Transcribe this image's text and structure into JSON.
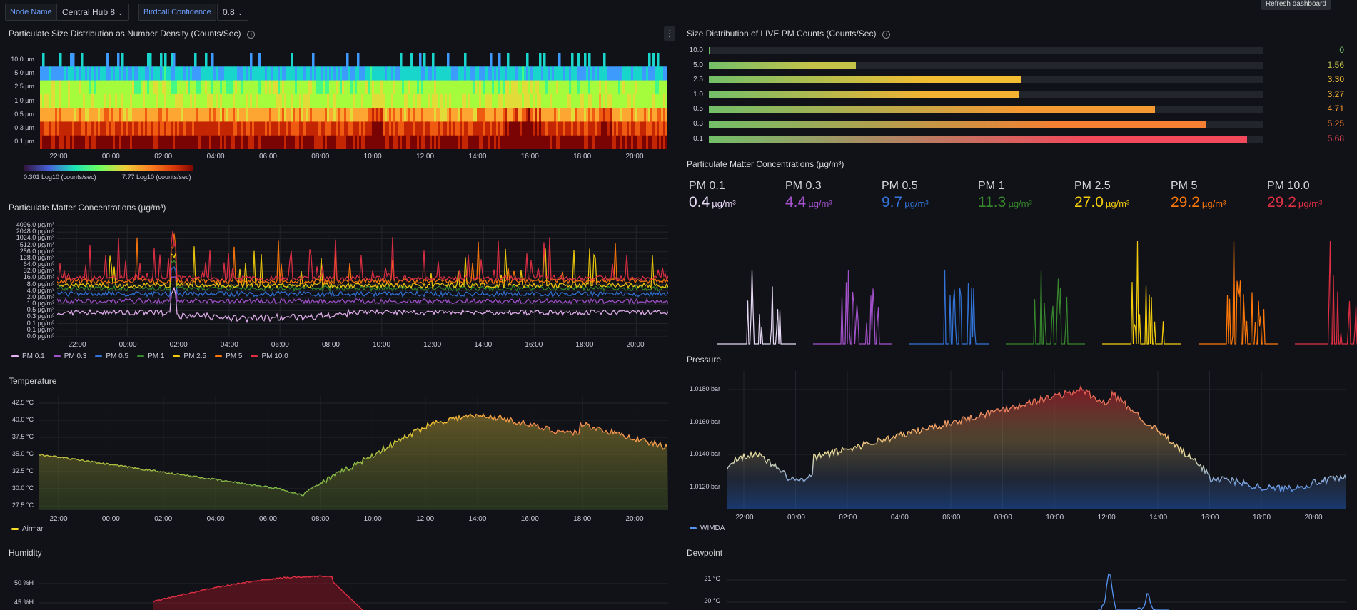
{
  "variables": {
    "node_name_label": "Node Name",
    "node_name_value": "Central Hub 8",
    "birdcall_label": "Birdcall Confidence",
    "birdcall_value": "0.8"
  },
  "tooltip": "Refresh dashboard",
  "time_ticks": [
    "22:00",
    "00:00",
    "02:00",
    "04:00",
    "06:00",
    "08:00",
    "10:00",
    "12:00",
    "14:00",
    "16:00",
    "18:00",
    "20:00"
  ],
  "heatmap": {
    "title": "Particulate Size Distribution as Number Density (Counts/Sec)",
    "rows": [
      "10.0 µm",
      "5.0 µm",
      "2.5 µm",
      "1.0 µm",
      "0.5 µm",
      "0.3 µm",
      "0.1 µm"
    ],
    "scale_min": "0.301 Log10 (counts/sec)",
    "scale_max": "7.77 Log10 (counts/sec)"
  },
  "live_pm": {
    "title": "Size Distribution of LIVE PM Counts (Counts/Sec)",
    "rows": [
      {
        "label": "10.0",
        "value": "0",
        "fraction": 0.002,
        "color": "#73bf69"
      },
      {
        "label": "5.0",
        "value": "1.56",
        "fraction": 0.266,
        "color": "#c5c24a"
      },
      {
        "label": "2.5",
        "value": "3.30",
        "fraction": 0.565,
        "color": "#f2bd32"
      },
      {
        "label": "1.0",
        "value": "3.27",
        "fraction": 0.56,
        "color": "#f2b232"
      },
      {
        "label": "0.5",
        "value": "4.71",
        "fraction": 0.805,
        "color": "#f59932"
      },
      {
        "label": "0.3",
        "value": "5.25",
        "fraction": 0.898,
        "color": "#f57f32"
      },
      {
        "label": "0.1",
        "value": "5.68",
        "fraction": 0.972,
        "color": "#f2495c"
      }
    ]
  },
  "pm_conc": {
    "title": "Particulate Matter Concentrations (µg/m³)",
    "y_ticks": [
      "4096.0 µg/m³",
      "2048.0 µg/m³",
      "1024.0 µg/m³",
      "512.0 µg/m³",
      "256.0 µg/m³",
      "128.0 µg/m³",
      "64.0 µg/m³",
      "32.0 µg/m³",
      "16.0 µg/m³",
      "8.0 µg/m³",
      "4.0 µg/m³",
      "2.0 µg/m³",
      "1.0 µg/m³",
      "0.5 µg/m³",
      "0.3 µg/m³",
      "0.1 µg/m³",
      "0.1 µg/m³",
      "0.0 µg/m³"
    ],
    "series": [
      {
        "name": "PM 0.1",
        "color": "#e7b3f2"
      },
      {
        "name": "PM 0.3",
        "color": "#a352cc"
      },
      {
        "name": "PM 0.5",
        "color": "#3274d9"
      },
      {
        "name": "PM 1",
        "color": "#37872d"
      },
      {
        "name": "PM 2.5",
        "color": "#f2cc0c"
      },
      {
        "name": "PM 5",
        "color": "#ff780a"
      },
      {
        "name": "PM 10.0",
        "color": "#e02f44"
      }
    ]
  },
  "pm_stats": {
    "title": "Particulate Matter Concentrations (µg/m³)",
    "items": [
      {
        "name": "PM 0.1",
        "value": "0.4",
        "unit": "µg/m³",
        "color": "#e7d9f5"
      },
      {
        "name": "PM 0.3",
        "value": "4.4",
        "unit": "µg/m³",
        "color": "#a352cc"
      },
      {
        "name": "PM 0.5",
        "value": "9.7",
        "unit": "µg/m³",
        "color": "#3274d9"
      },
      {
        "name": "PM 1",
        "value": "11.3",
        "unit": "µg/m³",
        "color": "#37872d"
      },
      {
        "name": "PM 2.5",
        "value": "27.0",
        "unit": "µg/m³",
        "color": "#f2cc0c"
      },
      {
        "name": "PM 5",
        "value": "29.2",
        "unit": "µg/m³",
        "color": "#ff780a"
      },
      {
        "name": "PM 10.0",
        "value": "29.2",
        "unit": "µg/m³",
        "color": "#e02f44"
      }
    ]
  },
  "temperature": {
    "title": "Temperature",
    "y_ticks": [
      "42.5 °C",
      "40.0 °C",
      "37.5 °C",
      "35.0 °C",
      "32.5 °C",
      "30.0 °C",
      "27.5 °C"
    ],
    "legend": "Airmar"
  },
  "pressure": {
    "title": "Pressure",
    "y_ticks": [
      "1.0180 bar",
      "1.0160 bar",
      "1.0140 bar",
      "1.0120 bar"
    ],
    "legend": "WIMDA"
  },
  "humidity": {
    "title": "Humidity",
    "y_ticks": [
      "50 %H",
      "45 %H"
    ]
  },
  "dewpoint": {
    "title": "Dewpoint",
    "y_ticks": [
      "21 °C",
      "20 °C"
    ]
  }
}
